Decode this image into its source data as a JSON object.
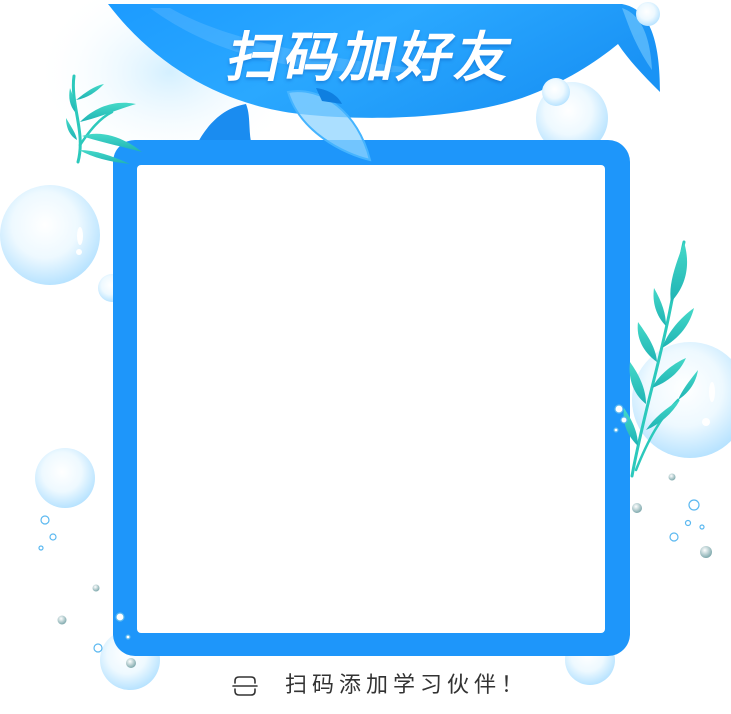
{
  "banner": {
    "title": "扫码加好友"
  },
  "caption": {
    "icon": "scan-icon",
    "text": "扫码添加学习伙伴！"
  },
  "decorations": [
    "whale-tail-banner",
    "whale-fin",
    "whale-flipper",
    "seaweed",
    "bubble"
  ],
  "colors": {
    "background": "#FFFFFF",
    "frame": "#1E96FA",
    "banner": "#1C9BFF",
    "title_text": "#FFFFFF",
    "caption_text": "#333333",
    "seaweed": "#2CC9BC",
    "bubble": "#B8E3FF"
  }
}
